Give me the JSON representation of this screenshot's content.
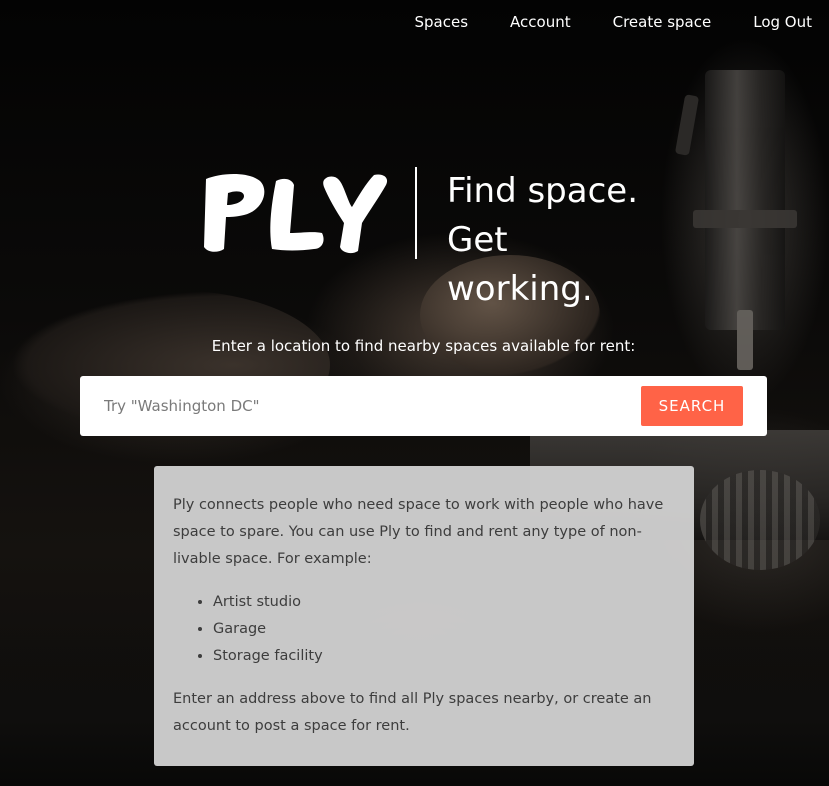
{
  "nav": {
    "items": [
      {
        "label": "Spaces"
      },
      {
        "label": "Account"
      },
      {
        "label": "Create space"
      },
      {
        "label": "Log Out"
      }
    ]
  },
  "brand": {
    "logo_text": "PLY",
    "tagline_line1": "Find space.",
    "tagline_line2": "Get working."
  },
  "search": {
    "prompt": "Enter a location to find nearby spaces available for rent:",
    "placeholder": "Try \"Washington DC\"",
    "value": "",
    "button_label": "SEARCH"
  },
  "info": {
    "intro": "Ply connects people who need space to work with people who have space to spare. You can use Ply to find and rent any type of non-livable space. For example:",
    "examples": [
      "Artist studio",
      "Garage",
      "Storage facility"
    ],
    "outro": "Enter an address above to find all Ply spaces nearby, or create an account to post a space for rent."
  },
  "colors": {
    "accent": "#ff6347",
    "card_bg": "#cecece",
    "text": "#3d3d3d"
  }
}
